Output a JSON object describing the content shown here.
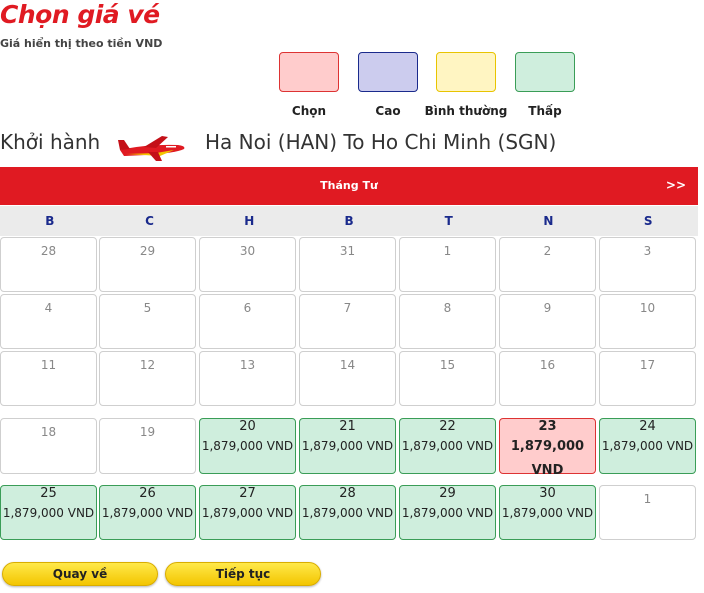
{
  "header": {
    "title": "Chọn giá vé",
    "subtitle": "Giá hiển thị theo tiền VND"
  },
  "legend": [
    {
      "label": "Chọn",
      "fill": "#ffcccc",
      "border": "#dd3333"
    },
    {
      "label": "Cao",
      "fill": "#ccccee",
      "border": "#1a2a8c"
    },
    {
      "label": "Bình thường",
      "fill": "#fff5c2",
      "border": "#e8c400"
    },
    {
      "label": "Thấp",
      "fill": "#cfeedd",
      "border": "#3a9d57"
    }
  ],
  "route": {
    "label": "Khởi hành",
    "text": "Ha Noi (HAN) To Ho Chi Minh (SGN)"
  },
  "calendar": {
    "month": "Tháng Tư",
    "next_label": ">>",
    "weekdays": [
      "B",
      "C",
      "H",
      "B",
      "T",
      "N",
      "S"
    ],
    "rows": [
      [
        {
          "d": "28"
        },
        {
          "d": "29"
        },
        {
          "d": "30"
        },
        {
          "d": "31"
        },
        {
          "d": "1"
        },
        {
          "d": "2"
        },
        {
          "d": "3"
        }
      ],
      [
        {
          "d": "4"
        },
        {
          "d": "5"
        },
        {
          "d": "6"
        },
        {
          "d": "7"
        },
        {
          "d": "8"
        },
        {
          "d": "9"
        },
        {
          "d": "10"
        }
      ],
      [
        {
          "d": "11"
        },
        {
          "d": "12"
        },
        {
          "d": "13"
        },
        {
          "d": "14"
        },
        {
          "d": "15"
        },
        {
          "d": "16"
        },
        {
          "d": "17"
        }
      ],
      [
        {
          "d": "18"
        },
        {
          "d": "19"
        },
        {
          "d": "20",
          "p": "1,879,000 VND",
          "s": "low"
        },
        {
          "d": "21",
          "p": "1,879,000 VND",
          "s": "low"
        },
        {
          "d": "22",
          "p": "1,879,000 VND",
          "s": "low"
        },
        {
          "d": "23",
          "p": "1,879,000 VND",
          "s": "sel"
        },
        {
          "d": "24",
          "p": "1,879,000 VND",
          "s": "low"
        }
      ],
      [
        {
          "d": "25",
          "p": "1,879,000 VND",
          "s": "low"
        },
        {
          "d": "26",
          "p": "1,879,000 VND",
          "s": "low"
        },
        {
          "d": "27",
          "p": "1,879,000 VND",
          "s": "low"
        },
        {
          "d": "28",
          "p": "1,879,000 VND",
          "s": "low"
        },
        {
          "d": "29",
          "p": "1,879,000 VND",
          "s": "low"
        },
        {
          "d": "30",
          "p": "1,879,000 VND",
          "s": "low"
        },
        {
          "d": "1"
        }
      ]
    ]
  },
  "buttons": {
    "back": "Quay về",
    "continue": "Tiếp tục"
  },
  "colors": {
    "brand_red": "#e01a22",
    "button_yellow": "#f3c500"
  }
}
